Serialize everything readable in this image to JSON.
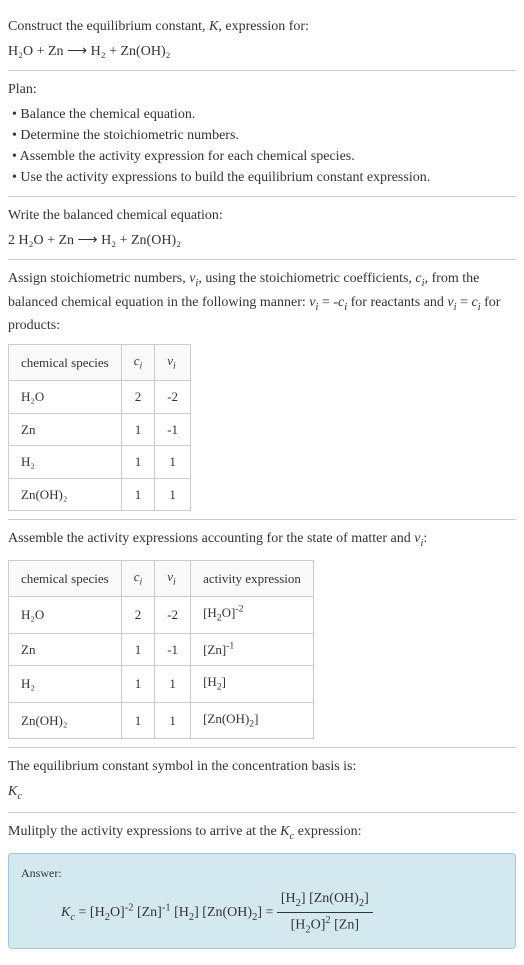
{
  "intro": {
    "prompt_text": "Construct the equilibrium constant, K, expression for:",
    "equation": "H₂O + Zn ⟶ H₂ + Zn(OH)₂"
  },
  "plan": {
    "heading": "Plan:",
    "items": [
      "• Balance the chemical equation.",
      "• Determine the stoichiometric numbers.",
      "• Assemble the activity expression for each chemical species.",
      "• Use the activity expressions to build the equilibrium constant expression."
    ]
  },
  "balanced": {
    "heading": "Write the balanced chemical equation:",
    "equation": "2 H₂O + Zn ⟶ H₂ + Zn(OH)₂"
  },
  "stoich": {
    "text_before": "Assign stoichiometric numbers, νᵢ, using the stoichiometric coefficients, cᵢ, from the balanced chemical equation in the following manner: νᵢ = -cᵢ for reactants and νᵢ = cᵢ for products:",
    "headers": {
      "species": "chemical species",
      "ci": "cᵢ",
      "vi": "νᵢ"
    },
    "rows": [
      {
        "species": "H₂O",
        "ci": "2",
        "vi": "-2"
      },
      {
        "species": "Zn",
        "ci": "1",
        "vi": "-1"
      },
      {
        "species": "H₂",
        "ci": "1",
        "vi": "1"
      },
      {
        "species": "Zn(OH)₂",
        "ci": "1",
        "vi": "1"
      }
    ]
  },
  "activity": {
    "heading": "Assemble the activity expressions accounting for the state of matter and νᵢ:",
    "headers": {
      "species": "chemical species",
      "ci": "cᵢ",
      "vi": "νᵢ",
      "expr": "activity expression"
    },
    "rows": [
      {
        "species": "H₂O",
        "ci": "2",
        "vi": "-2",
        "expr": "[H₂O]⁻²"
      },
      {
        "species": "Zn",
        "ci": "1",
        "vi": "-1",
        "expr": "[Zn]⁻¹"
      },
      {
        "species": "H₂",
        "ci": "1",
        "vi": "1",
        "expr": "[H₂]"
      },
      {
        "species": "Zn(OH)₂",
        "ci": "1",
        "vi": "1",
        "expr": "[Zn(OH)₂]"
      }
    ]
  },
  "symbol": {
    "heading": "The equilibrium constant symbol in the concentration basis is:",
    "value": "K_c"
  },
  "multiply": {
    "heading": "Mulitply the activity expressions to arrive at the K_c expression:"
  },
  "answer": {
    "label": "Answer:",
    "lhs": "K_c = [H₂O]⁻² [Zn]⁻¹ [H₂] [Zn(OH)₂] =",
    "frac_num": "[H₂] [Zn(OH)₂]",
    "frac_den": "[H₂O]² [Zn]"
  },
  "chart_data": {
    "type": "table",
    "tables": [
      {
        "title": "Stoichiometric numbers",
        "columns": [
          "chemical species",
          "cᵢ",
          "νᵢ"
        ],
        "rows": [
          [
            "H₂O",
            2,
            -2
          ],
          [
            "Zn",
            1,
            -1
          ],
          [
            "H₂",
            1,
            1
          ],
          [
            "Zn(OH)₂",
            1,
            1
          ]
        ]
      },
      {
        "title": "Activity expressions",
        "columns": [
          "chemical species",
          "cᵢ",
          "νᵢ",
          "activity expression"
        ],
        "rows": [
          [
            "H₂O",
            2,
            -2,
            "[H₂O]⁻²"
          ],
          [
            "Zn",
            1,
            -1,
            "[Zn]⁻¹"
          ],
          [
            "H₂",
            1,
            1,
            "[H₂]"
          ],
          [
            "Zn(OH)₂",
            1,
            1,
            "[Zn(OH)₂]"
          ]
        ]
      }
    ]
  }
}
